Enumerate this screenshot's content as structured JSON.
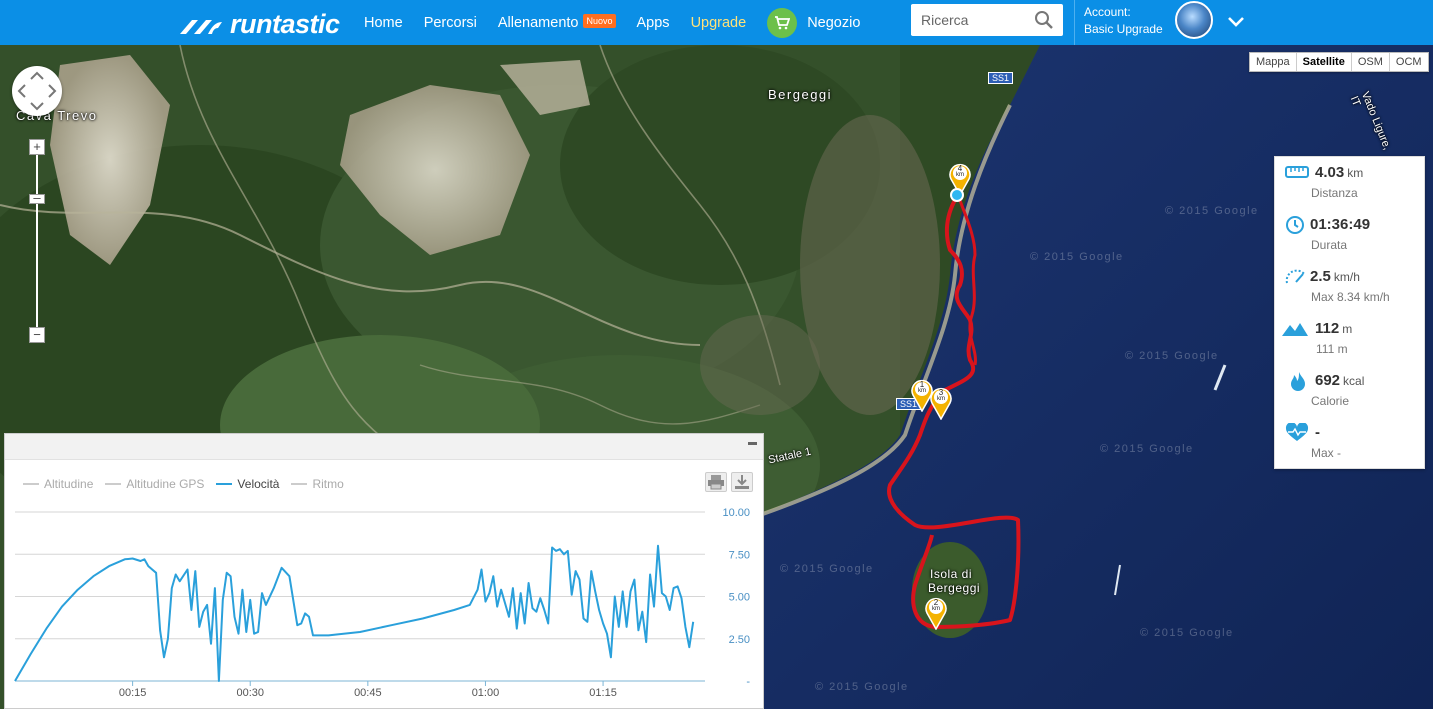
{
  "header": {
    "brand": "runtastic",
    "nav": [
      "Home",
      "Percorsi",
      "Allenamento",
      "Apps",
      "Upgrade",
      "Negozio"
    ],
    "badge": "Nuovo",
    "search_placeholder": "Ricerca",
    "account_label": "Account:",
    "account_plan": "Basic Upgrade"
  },
  "map": {
    "types": [
      "Mappa",
      "Satellite",
      "OSM",
      "OCM"
    ],
    "active_type": "Satellite",
    "places": [
      "Cava Trevo",
      "Bergeggi",
      "Isola di",
      "Bergeggi"
    ],
    "road_labels": [
      "SS1",
      "SS1",
      "Statale 1",
      "Vado Ligure, IT"
    ],
    "watermark": "© 2015 Google",
    "markers": [
      {
        "label": "1",
        "unit": "km"
      },
      {
        "label": "2",
        "unit": "km"
      },
      {
        "label": "3",
        "unit": "km"
      },
      {
        "label": "4",
        "unit": "km"
      }
    ],
    "zoom_in": "+",
    "zoom_out": "−"
  },
  "stats": {
    "distance": {
      "value": "4.03",
      "unit": "km",
      "label": "Distanza"
    },
    "duration": {
      "value": "01:36:49",
      "label": "Durata"
    },
    "speed": {
      "value": "2.5",
      "unit": "km/h",
      "label": "Max 8.34 km/h"
    },
    "elevation": {
      "value": "112",
      "unit": "m",
      "label": "111 m"
    },
    "calories": {
      "value": "692",
      "unit": "kcal",
      "label": "Calorie"
    },
    "heart": {
      "value": "-",
      "label": "Max -"
    }
  },
  "chart_panel": {
    "legend": [
      "Altitudine",
      "Altitudine GPS",
      "Velocità",
      "Ritmo"
    ],
    "active": "Velocità",
    "colors": {
      "speed": "#2aa0db",
      "grid": "#d6d6d6",
      "axis": "#7cb5d6"
    }
  },
  "chart_data": {
    "type": "line",
    "xlabel": "",
    "ylabel": "",
    "x_ticks": [
      "00:15",
      "00:30",
      "00:45",
      "01:00",
      "01:15"
    ],
    "y_ticks": [
      "-",
      "2.50",
      "5.00",
      "7.50",
      "10.00"
    ],
    "xlim": [
      0,
      88
    ],
    "ylim": [
      0,
      10
    ],
    "series": [
      {
        "values_x": [
          0,
          2,
          4,
          6,
          8,
          10,
          12,
          14,
          15,
          16,
          16.5,
          17,
          17.5,
          18,
          18.5,
          19,
          19.5,
          20,
          20.5,
          21,
          22,
          22.5,
          23,
          23.5,
          24,
          24.5,
          25,
          25.5,
          26,
          26.5,
          27,
          27.5,
          28,
          28.5,
          29,
          29.5,
          30,
          30.5,
          31,
          31.5,
          32,
          33,
          34,
          35,
          36,
          36.5,
          37,
          37.5,
          38,
          38.5,
          39,
          39.5,
          40,
          41,
          44,
          48,
          52,
          56,
          58,
          59,
          59.5,
          60,
          60.5,
          61,
          61.5,
          62,
          63,
          63.5,
          64,
          64.5,
          65,
          65.5,
          66,
          66.5,
          67,
          67.5,
          68,
          68.5,
          69,
          69.5,
          70,
          70.5,
          71,
          71.5,
          72,
          72.5,
          73,
          73.5,
          74,
          74.5,
          75,
          75.5,
          76,
          76.5,
          77,
          77.5,
          78,
          78.5,
          79,
          79.5,
          80,
          80.5,
          81,
          81.5,
          82,
          82.5,
          83,
          83.5,
          84,
          84.5,
          85,
          85.5,
          86,
          86.5
        ],
        "values_y": [
          0,
          1.6,
          3.1,
          4.4,
          5.4,
          6.2,
          6.8,
          7.2,
          7.25,
          7.1,
          7.2,
          6.8,
          6.6,
          6.4,
          3.0,
          1.4,
          2.5,
          5.5,
          6.3,
          5.9,
          6.6,
          4.2,
          6.5,
          3.2,
          4.1,
          4.5,
          2.2,
          5.5,
          0,
          4.8,
          6.4,
          6.2,
          3.8,
          2.8,
          5.4,
          2.9,
          4.8,
          2.8,
          2.9,
          5.2,
          4.5,
          5.5,
          6.7,
          6.2,
          3.3,
          3.4,
          4.0,
          3.8,
          2.7,
          2.7,
          2.7,
          2.7,
          2.7,
          2.75,
          2.9,
          3.3,
          3.7,
          4.2,
          4.5,
          5.4,
          6.6,
          4.7,
          5.2,
          6.2,
          4.4,
          5.4,
          3.8,
          5.5,
          3.1,
          5.2,
          3.4,
          5.8,
          4.3,
          4.1,
          4.9,
          4.2,
          3.4,
          7.9,
          7.7,
          7.8,
          7.5,
          7.7,
          5.1,
          6.5,
          6.0,
          3.7,
          3.5,
          6.5,
          5.3,
          4.2,
          3.4,
          2.8,
          1.4,
          5.0,
          3.2,
          5.3,
          3.2,
          5.3,
          6.0,
          3.0,
          4.1,
          2.3,
          6.3,
          4.4,
          8.0,
          5.2,
          5.0,
          4.2,
          5.5,
          5.6,
          4.9,
          3.2,
          2.0,
          3.5
        ]
      }
    ]
  }
}
